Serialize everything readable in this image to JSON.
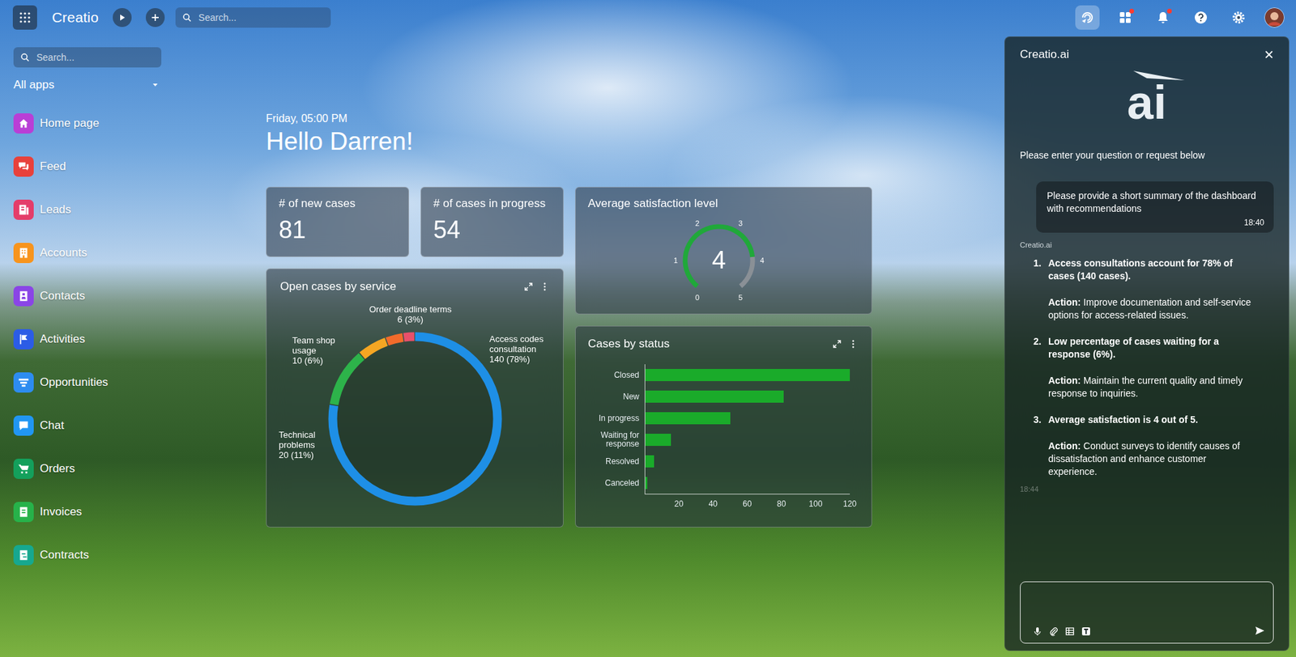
{
  "topbar": {
    "brand": "Creatio",
    "search_placeholder": "Search...",
    "apps_badge": true,
    "notifications_badge": true
  },
  "sidebar": {
    "search_placeholder": "Search...",
    "app_filter": "All apps",
    "items": [
      {
        "label": "Home page",
        "color": "#b93fd6"
      },
      {
        "label": "Feed",
        "color": "#e8413b"
      },
      {
        "label": "Leads",
        "color": "#e43d6a"
      },
      {
        "label": "Accounts",
        "color": "#f7941d"
      },
      {
        "label": "Contacts",
        "color": "#8a45e6"
      },
      {
        "label": "Activities",
        "color": "#2b5ce6"
      },
      {
        "label": "Opportunities",
        "color": "#2d8cf0"
      },
      {
        "label": "Chat",
        "color": "#2196f3"
      },
      {
        "label": "Orders",
        "color": "#14a05c"
      },
      {
        "label": "Invoices",
        "color": "#27b24a"
      },
      {
        "label": "Contracts",
        "color": "#16a88f"
      }
    ]
  },
  "greeting": {
    "datetime": "Friday, 05:00 PM",
    "title": "Hello Darren!"
  },
  "kpis": [
    {
      "title": "# of new cases",
      "value": "81"
    },
    {
      "title": "# of cases in progress",
      "value": "54"
    }
  ],
  "satisfaction": {
    "title": "Average satisfaction level",
    "value": "4",
    "level": 0.8,
    "ticks": [
      "0",
      "1",
      "2",
      "3",
      "4",
      "5"
    ]
  },
  "service_chart": {
    "title": "Open cases by service",
    "segments": [
      {
        "label": "Access codes consultation",
        "reading": "140 (78%)",
        "value": 140,
        "color": "#1e8fe6"
      },
      {
        "label": "Technical problems",
        "reading": "20 (11%)",
        "value": 20,
        "color": "#2db34a"
      },
      {
        "label": "Team shop usage",
        "reading": "10 (6%)",
        "value": 10,
        "color": "#f5a623"
      },
      {
        "label": "Order deadline terms",
        "reading": "6 (3%)",
        "value": 6,
        "color": "#f26b2b"
      },
      {
        "value": 4,
        "color": "#e8506a"
      }
    ]
  },
  "status_chart": {
    "title": "Cases by status",
    "categories": [
      "Closed",
      "New",
      "In progress",
      "Waiting for response",
      "Resolved",
      "Canceled"
    ],
    "values": [
      120,
      81,
      50,
      15,
      5,
      1
    ],
    "ticks": [
      "20",
      "40",
      "60",
      "80",
      "100",
      "120"
    ]
  },
  "assistant": {
    "title": "Creatio.ai",
    "close": "×",
    "logo": "ai",
    "prompt": "Please enter your question or request below",
    "messages": [
      {
        "kind": "user",
        "text": "Please provide a short summary of the dashboard with recommendations",
        "time": "18:40"
      },
      {
        "kind": "bot",
        "sender": "Creatio.ai",
        "time": "18:44",
        "items": [
          {
            "number": "1.",
            "heading": "Access consultations account for 78% of cases (140 cases).",
            "action_label": "Action:",
            "action": "Improve documentation and self-service options for access-related issues."
          },
          {
            "number": "2.",
            "heading": "Low percentage of cases waiting for a response (6%).",
            "action_label": "Action:",
            "action": "Maintain the current quality and timely response to inquiries."
          },
          {
            "number": "3.",
            "heading": "Average satisfaction is 4 out of 5.",
            "action_label": "Action:",
            "action": "Conduct surveys to identify causes of dissatisfaction and enhance customer experience."
          }
        ]
      }
    ]
  }
}
